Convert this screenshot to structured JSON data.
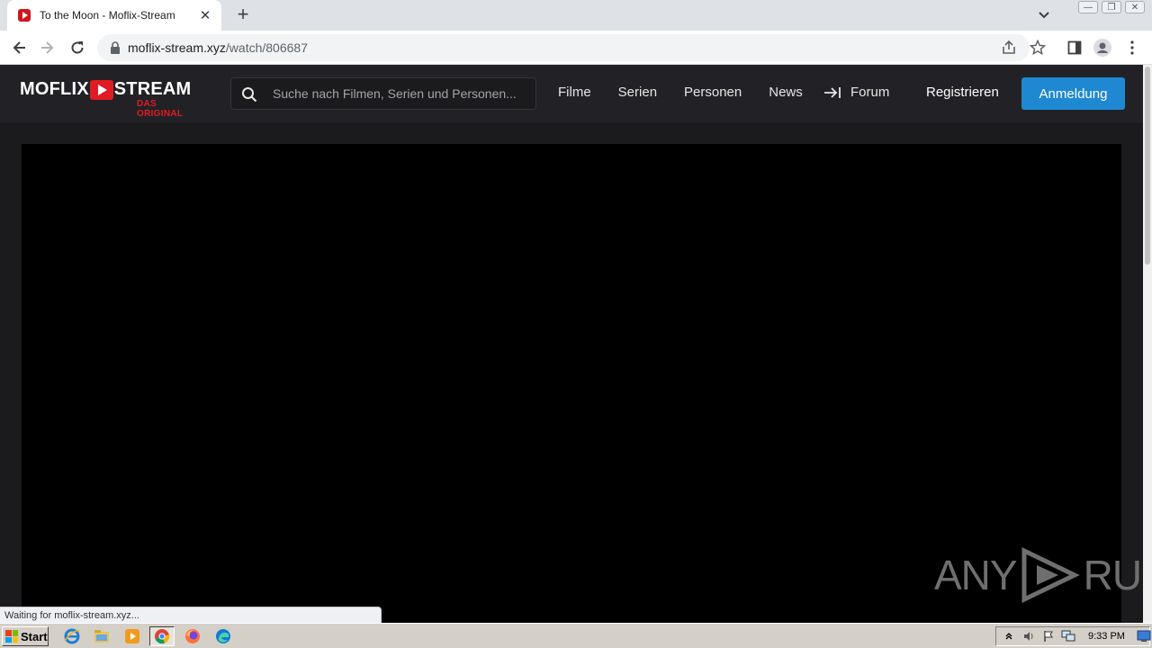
{
  "browser": {
    "tab_title": "To the Moon - Moflix-Stream",
    "tab_close": "✕",
    "new_tab": "+",
    "url_host": "moflix-stream.xyz",
    "url_path": "/watch/806687",
    "window_controls": {
      "minimize": "—",
      "restore": "❐",
      "close": "✕"
    },
    "status_text": "Waiting for moflix-stream.xyz..."
  },
  "site": {
    "logo_main_left": "MOFLIX",
    "logo_main_right": "STREAM",
    "logo_sub": "DAS ORIGINAL",
    "search_placeholder": "Suche nach Filmen, Serien und Personen...",
    "nav": [
      "Filme",
      "Serien",
      "Personen",
      "News"
    ],
    "forum": "Forum",
    "register": "Registrieren",
    "login": "Anmeldung",
    "accent_color": "#e01b24",
    "button_color": "#1e88d2"
  },
  "watermark": {
    "left": "ANY",
    "right": "RUN"
  },
  "taskbar": {
    "start_label": "Start",
    "clock": "9:33 PM",
    "apps": [
      "ie-icon",
      "explorer-icon",
      "media-player-icon",
      "chrome-icon",
      "firefox-icon",
      "edge-icon"
    ]
  }
}
